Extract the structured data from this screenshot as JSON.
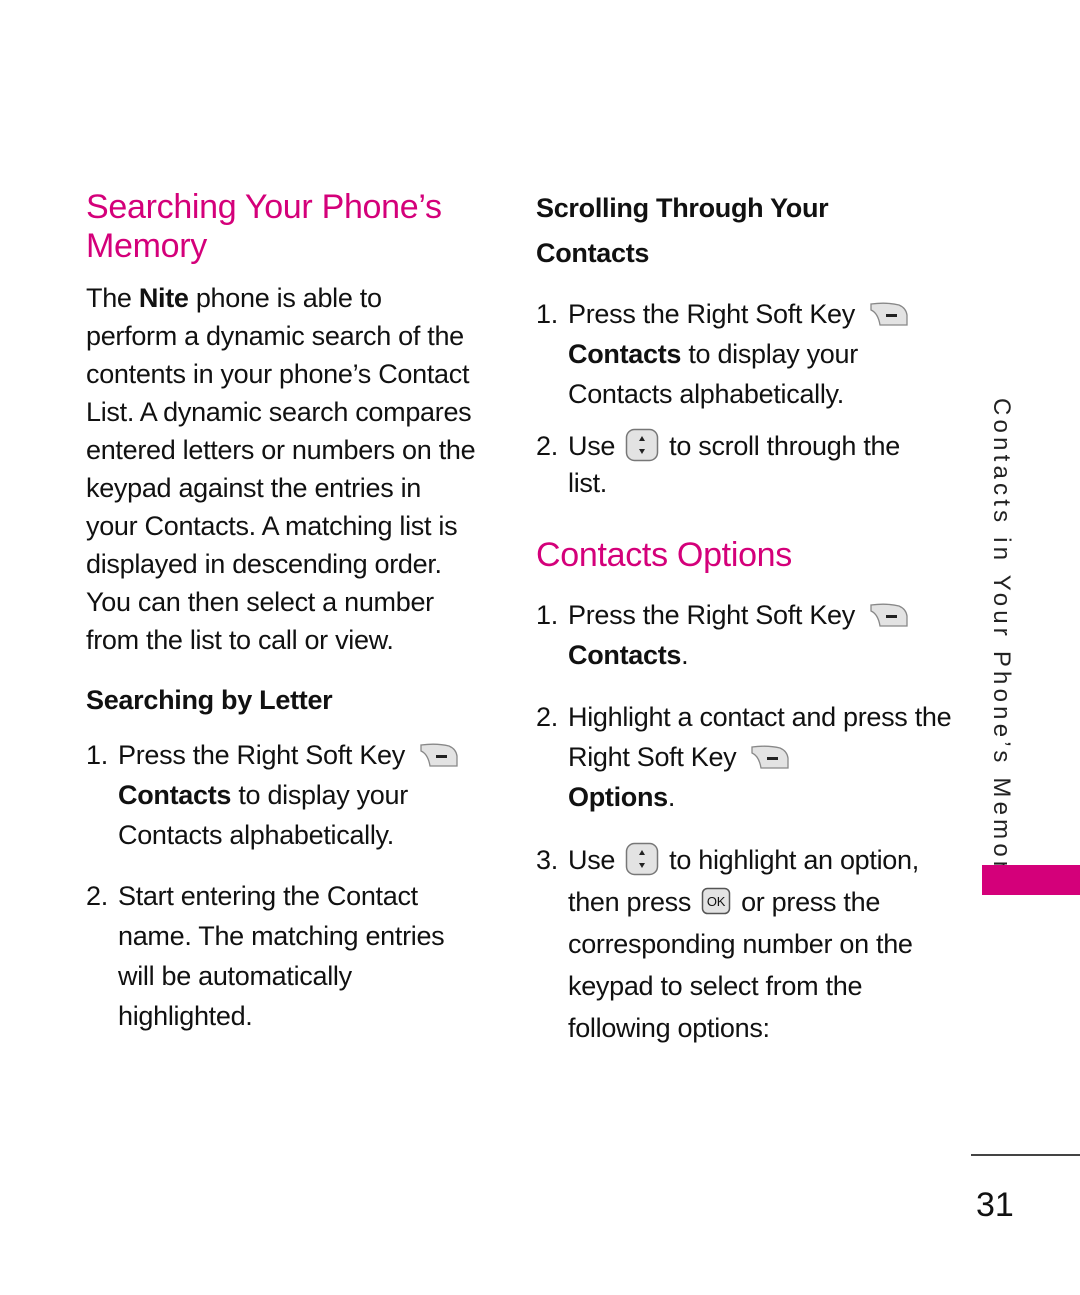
{
  "left_column": {
    "title": "Searching Your Phone’s Memory",
    "intro": {
      "prefix": "The ",
      "bold": "Nite",
      "suffix": " phone is able to perform a dynamic search of the contents in your phone’s Contact List. A dynamic search compares entered letters or numbers on the keypad against the entries in your Contacts. A matching list is displayed in descending order. You can then select a number from the list to call or view."
    },
    "subheading": "Searching by Letter",
    "steps": [
      {
        "num": "1.",
        "text_before_icon": "Press the Right Soft Key",
        "icon": "right-soft-key-icon",
        "bold": "Contacts",
        "text_after": " to display your Contacts alphabetically."
      },
      {
        "num": "2.",
        "text": "Start entering the Contact name. The matching entries will be automatically highlighted."
      }
    ]
  },
  "right_column": {
    "subheading": "Scrolling Through Your Contacts",
    "scroll_steps": [
      {
        "num": "1.",
        "text_before_icon": "Press the Right Soft Key",
        "icon": "right-soft-key-icon",
        "bold": "Contacts",
        "text_after": " to display your Contacts alphabetically."
      },
      {
        "num": "2.",
        "prefix": "Use",
        "icon": "navigation-key-icon",
        "suffix": "to scroll through the list."
      }
    ],
    "options_title": "Contacts Options",
    "options_steps": [
      {
        "num": "1.",
        "text_before_icon": "Press the Right Soft Key",
        "icon": "right-soft-key-icon",
        "bold": "Contacts",
        "text_after": "."
      },
      {
        "num": "2.",
        "text_before_icon": "Highlight a contact and press the Right Soft Key",
        "icon": "right-soft-key-icon",
        "bold": "Options",
        "text_after": "."
      },
      {
        "num": "3.",
        "prefix": "Use",
        "icon": "navigation-key-icon",
        "middle": "to highlight an option, then press",
        "icon2": "ok-key-icon",
        "suffix": "or press the corresponding number on the keypad to select from the following options:"
      }
    ]
  },
  "side_tab": {
    "label": "Contacts in Your Phone’s Memory",
    "color": "#d4007a"
  },
  "footer": {
    "page_number": "31"
  },
  "colors": {
    "accent": "#d4007a",
    "text": "#111111",
    "key_fill": "#e3e3e3",
    "key_stroke": "#777777"
  },
  "icons": {
    "ok_label": "OK"
  }
}
